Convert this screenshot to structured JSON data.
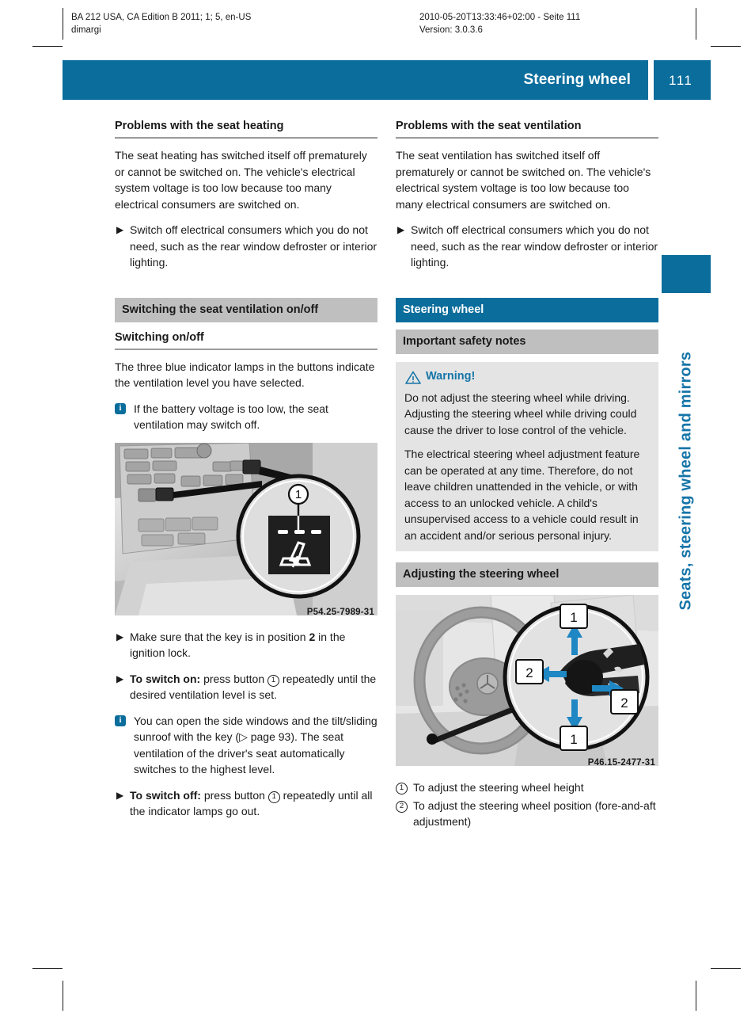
{
  "runhead": {
    "left_line1": "BA 212 USA, CA Edition B 2011; 1; 5, en-US",
    "left_line2": "dimargi",
    "right_line1": "2010-05-20T13:33:46+02:00 - Seite 111",
    "right_line2": "Version: 3.0.3.6"
  },
  "header": {
    "title": "Steering wheel",
    "page_number": "111"
  },
  "side_tab": {
    "label": "Seats, steering wheel and mirrors"
  },
  "colors": {
    "brand_blue": "#0a6d9c",
    "tab_blue": "#1675a8",
    "grey_bar": "#bfbfbf",
    "warn_bg": "#e4e4e4"
  },
  "left_column": {
    "heading1": "Problems with the seat heating",
    "para1": "The seat heating has switched itself off prematurely or cannot be switched on. The vehicle's electrical system voltage is too low because too many electrical consumers are switched on.",
    "step1": "Switch off electrical consumers which you do not need, such as the rear window defroster or interior lighting.",
    "grey_bar": "Switching the seat ventilation on/off",
    "heading2": "Switching on/off",
    "para2": "The three blue indicator lamps in the buttons indicate the ventilation level you have selected.",
    "note1": "If the battery voltage is too low, the seat ventilation may switch off.",
    "figure": {
      "caption": "P54.25-7989-31",
      "callout_number": "1",
      "alt": "Center console seat ventilation button, magnified"
    },
    "step2_a": "Make sure that the key is in position ",
    "step2_bold": "2",
    "step2_b": " in the ignition lock.",
    "step3_bold": "To switch on:",
    "step3_a": " press button ",
    "step3_num": "1",
    "step3_b": " repeatedly until the desired ventilation level is set.",
    "note2_a": "You can open the side windows and the tilt/sliding sunroof with the key (",
    "note2_ref": "▷ page 93",
    "note2_b": "). The seat ventilation of the driver's seat automatically switches to the highest level.",
    "step4_bold": "To switch off:",
    "step4_a": " press button ",
    "step4_num": "1",
    "step4_b": " repeatedly until all the indicator lamps go out."
  },
  "right_column": {
    "heading1": "Problems with the seat ventilation",
    "para1": "The seat ventilation has switched itself off prematurely or cannot be switched on. The vehicle's electrical system voltage is too low because too many electrical consumers are switched on.",
    "step1": "Switch off electrical consumers which you do not need, such as the rear window defroster or interior lighting.",
    "blue_bar": "Steering wheel",
    "grey_bar": "Important safety notes",
    "warning": {
      "title": "Warning!",
      "para1": "Do not adjust the steering wheel while driving. Adjusting the steering wheel while driving could cause the driver to lose control of the vehicle.",
      "para2": "The electrical steering wheel adjustment feature can be operated at any time. Therefore, do not leave children unattended in the vehicle, or with access to an unlocked vehicle. A child's unsupervised access to a vehicle could result in an accident and/or serious personal injury."
    },
    "grey_bar2": "Adjusting the steering wheel",
    "figure": {
      "caption": "P46.15-2477-31",
      "callout_numbers": [
        "1",
        "2",
        "2",
        "1"
      ],
      "alt": "Steering wheel with adjustment lever, magnified"
    },
    "legend": [
      {
        "num": "1",
        "text": "To adjust the steering wheel height"
      },
      {
        "num": "2",
        "text": "To adjust the steering wheel position (fore-and-aft adjustment)"
      }
    ]
  }
}
